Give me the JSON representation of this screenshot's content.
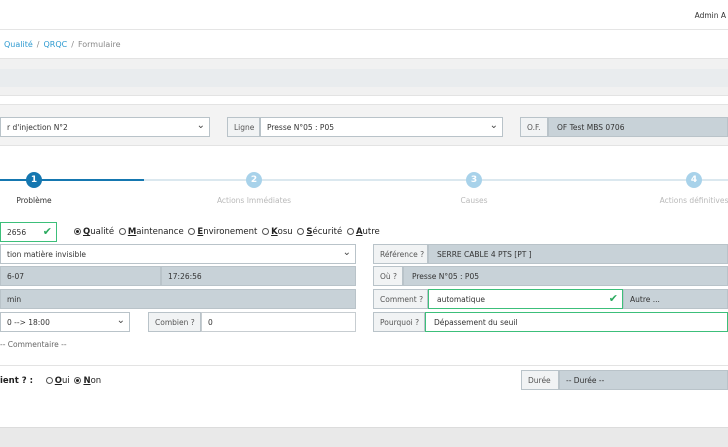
{
  "header": {
    "user": "Admin A"
  },
  "breadcrumb": {
    "items": [
      "Qualité",
      "QRQC"
    ],
    "current": "Formulaire"
  },
  "selectors": {
    "machine": "r d'injection N°2",
    "ligne_label": "Ligne",
    "ligne_value": "Presse N°05 : P05",
    "of_label": "O.F.",
    "of_value": "OF Test MBS 0706"
  },
  "stepper": {
    "steps": [
      {
        "number": "1",
        "label": "Problème"
      },
      {
        "number": "2",
        "label": "Actions Immédiates"
      },
      {
        "number": "3",
        "label": "Causes"
      },
      {
        "number": "4",
        "label": "Actions définitives"
      }
    ]
  },
  "form": {
    "code": "2656",
    "categories": [
      {
        "initial": "Q",
        "rest": "ualité",
        "selected": true
      },
      {
        "initial": "M",
        "rest": "aintenance",
        "selected": false
      },
      {
        "initial": "E",
        "rest": "nvironement",
        "selected": false
      },
      {
        "initial": "K",
        "rest": "osu",
        "selected": false
      },
      {
        "initial": "S",
        "rest": "écurité",
        "selected": false
      },
      {
        "initial": "A",
        "rest": "utre",
        "selected": false
      }
    ],
    "defect": "tion matière invisible",
    "date": "6-07",
    "time": "17:26:56",
    "user": "min",
    "range": "0 --> 18:00",
    "combien_label": "Combien ?",
    "combien_value": "0",
    "reference_label": "Référence ?",
    "reference_value": "SERRE CABLE 4 PTS [PT ]",
    "ou_label": "Où ?",
    "ou_value": "Presse N°05 : P05",
    "comment_label": "Comment ?",
    "comment_value": "automatique",
    "autre_placeholder": "Autre ...",
    "pourquoi_label": "Pourquoi ?",
    "pourquoi_value": "Dépassement du seuil",
    "commentaire_placeholder": "-- Commentaire --"
  },
  "bottom": {
    "question": "ient ? :",
    "oui_initial": "O",
    "oui_rest": "ui",
    "non_initial": "N",
    "non_rest": "on",
    "answer": "non",
    "duree_label": "Durée",
    "duree_placeholder": "-- Durée --"
  }
}
